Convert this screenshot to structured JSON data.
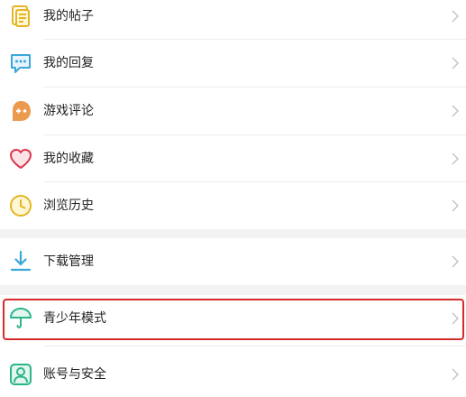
{
  "menu": {
    "items": [
      {
        "label": "我的帖子",
        "icon": "document-icon"
      },
      {
        "label": "我的回复",
        "icon": "chat-bubble-icon"
      },
      {
        "label": "游戏评论",
        "icon": "gamepad-icon"
      },
      {
        "label": "我的收藏",
        "icon": "heart-icon"
      },
      {
        "label": "浏览历史",
        "icon": "clock-icon"
      },
      {
        "label": "下载管理",
        "icon": "download-icon"
      },
      {
        "label": "青少年模式",
        "icon": "umbrella-icon"
      },
      {
        "label": "账号与安全",
        "icon": "user-icon"
      }
    ]
  },
  "highlighted_item": "青少年模式",
  "colors": {
    "highlight_border": "#d52a2a",
    "background": "#f3f3f3",
    "document_icon": "#e6b422",
    "chat_icon": "#3aa6d9",
    "gamepad_icon": "#ec9a4e",
    "heart_icon": "#d9364e",
    "clock_icon": "#e6b422",
    "download_icon": "#3aa6d9",
    "umbrella_icon": "#2bb58a",
    "user_icon": "#2bb58a"
  }
}
